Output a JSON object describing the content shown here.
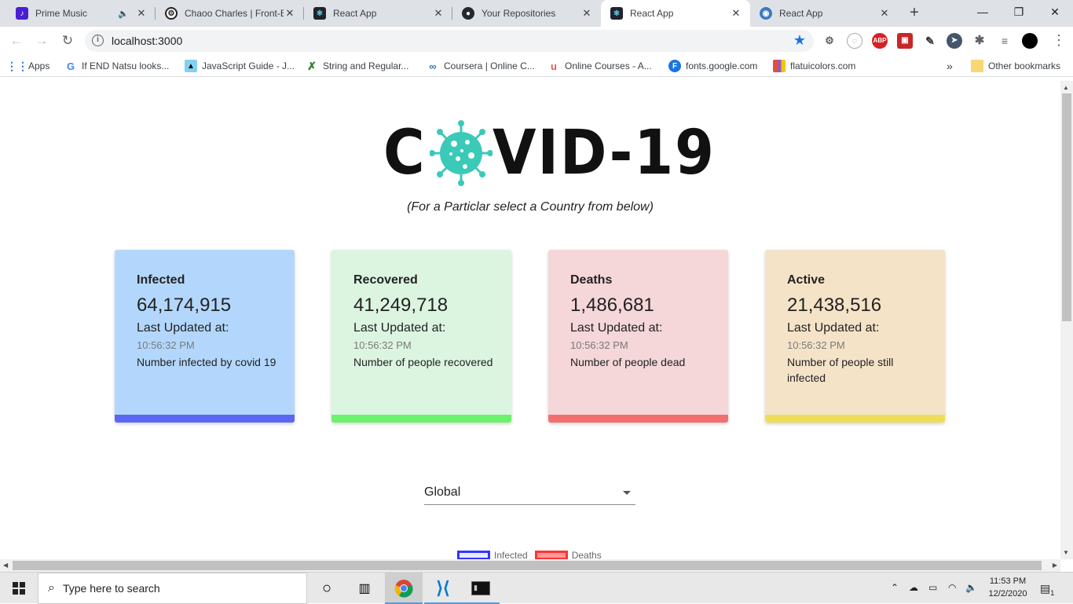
{
  "browser": {
    "tabs": [
      {
        "title": "Prime Music",
        "icon": "prime-music-icon",
        "color": "#4a1fd1",
        "audio": true
      },
      {
        "title": "Chaoo Charles | Front-E",
        "icon": "chaoo-charles-icon",
        "color": "#222222"
      },
      {
        "title": "React App",
        "icon": "react-icon",
        "color": "#20232a"
      },
      {
        "title": "Your Repositories",
        "icon": "github-icon",
        "color": "#24292e"
      },
      {
        "title": "React App",
        "icon": "react-icon",
        "color": "#20232a",
        "active": true
      },
      {
        "title": "React App",
        "icon": "react-globe-icon",
        "color": "#3b7bbf"
      }
    ],
    "url": "localhost:3000",
    "bookmarks": [
      {
        "label": "Apps",
        "icon": "apps-grid-icon"
      },
      {
        "label": "If END Natsu looks...",
        "icon": "google-icon"
      },
      {
        "label": "JavaScript Guide - J...",
        "icon": "mdn-icon"
      },
      {
        "label": "String and Regular...",
        "icon": "x-icon"
      },
      {
        "label": "Coursera | Online C...",
        "icon": "coursera-icon"
      },
      {
        "label": "Online Courses - A...",
        "icon": "udemy-icon"
      },
      {
        "label": "fonts.google.com",
        "icon": "f-icon"
      },
      {
        "label": "flatuicolors.com",
        "icon": "flatui-icon"
      }
    ],
    "other_bookmarks": "Other bookmarks",
    "overflow": "»"
  },
  "page": {
    "logo_left": "C",
    "logo_right": "VID-19",
    "subtitle": "(For a Particlar select a Country from below)",
    "cards": [
      {
        "label": "Infected",
        "value": "64,174,915",
        "updated": "Last Updated at:",
        "time": "10:56:32 PM",
        "desc": "Number infected by covid 19",
        "bg": "#b3d7fc",
        "accent": "#5b67f0"
      },
      {
        "label": "Recovered",
        "value": "41,249,718",
        "updated": "Last Updated at:",
        "time": "10:56:32 PM",
        "desc": "Number of people recovered",
        "bg": "#dcf5e0",
        "accent": "#6cf26c"
      },
      {
        "label": "Deaths",
        "value": "1,486,681",
        "updated": "Last Updated at:",
        "time": "10:56:32 PM",
        "desc": "Number of people dead",
        "bg": "#f5d6d9",
        "accent": "#f07070"
      },
      {
        "label": "Active",
        "value": "21,438,516",
        "updated": "Last Updated at:",
        "time": "10:56:32 PM",
        "desc": "Number of people still infected",
        "bg": "#f5e3c8",
        "accent": "#eedd5a"
      }
    ],
    "country_select": "Global",
    "legend": [
      {
        "label": "Infected",
        "color": "#3333ff"
      },
      {
        "label": "Deaths",
        "color": "#ff3333"
      }
    ]
  },
  "taskbar": {
    "search_placeholder": "Type here to search",
    "time": "11:53 PM",
    "date": "12/2/2020",
    "notifications": "1"
  }
}
